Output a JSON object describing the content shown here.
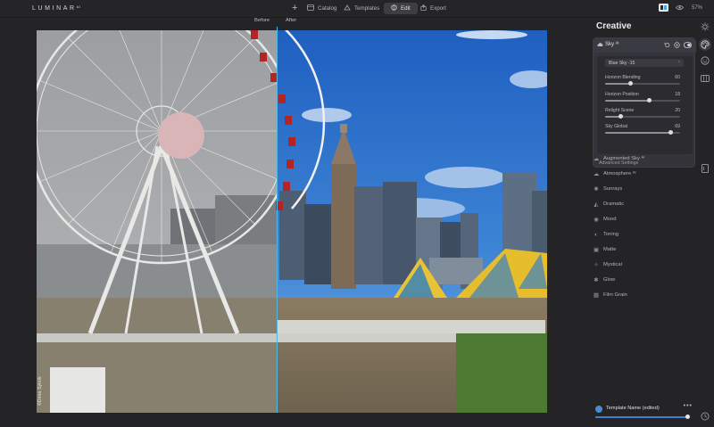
{
  "app": {
    "name": "LUMINAR",
    "edition": "AI"
  },
  "toolbar": {
    "catalog_label": "Catalog",
    "templates_label": "Templates",
    "edit_label": "Edit",
    "export_label": "Export",
    "zoom": "57%"
  },
  "compare": {
    "before_label": "Before",
    "after_label": "After"
  },
  "photo": {
    "credit": "©Dima Sytnik"
  },
  "panel": {
    "title": "Creative",
    "sky": {
      "name": "Sky ᴬᴵ",
      "preset": "Blue Sky -15",
      "sliders": [
        {
          "label": "Horizon Blending",
          "value": "60",
          "fraction": 0.34
        },
        {
          "label": "Horizon Position",
          "value": "18",
          "fraction": 0.59
        },
        {
          "label": "Relight Scene",
          "value": "20",
          "fraction": 0.21
        },
        {
          "label": "Sky Global",
          "value": "69",
          "fraction": 0.88
        }
      ],
      "advanced": "Advanced Settings"
    },
    "tools": [
      {
        "label": "Augmented Sky ᴬᴵ",
        "icon": "cloud-icon"
      },
      {
        "label": "Atmosphere ᴬᴵ",
        "icon": "cloud-icon"
      },
      {
        "label": "Sunrays",
        "icon": "sun-icon"
      },
      {
        "label": "Dramatic",
        "icon": "dramatic-icon"
      },
      {
        "label": "Mood",
        "icon": "mood-icon"
      },
      {
        "label": "Toning",
        "icon": "toning-icon"
      },
      {
        "label": "Matte",
        "icon": "matte-icon"
      },
      {
        "label": "Mystical",
        "icon": "mystical-icon"
      },
      {
        "label": "Glow",
        "icon": "glow-icon"
      },
      {
        "label": "Film Grain",
        "icon": "film-grain-icon"
      }
    ]
  },
  "template": {
    "name": "Template Name (edited)",
    "amount": 1.0
  }
}
